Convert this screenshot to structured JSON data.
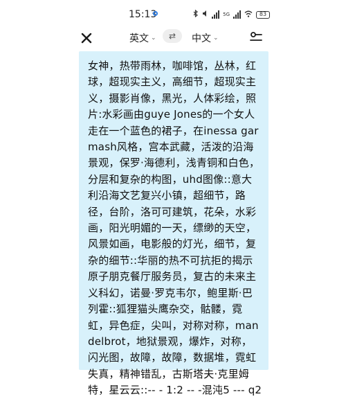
{
  "status_bar": {
    "time": "15:13",
    "network_label": "5G",
    "battery": "83"
  },
  "toolbar": {
    "source_language": "英文",
    "target_language": "中文",
    "swap_icon": "⇄"
  },
  "content": {
    "text": "女神，热带雨林，咖啡馆，丛林，红球，超现实主义，高细节，超现实主义，摄影肖像，黑光，人体彩绘，照片:水彩画由guye Jones的一个女人走在一个蓝色的裙子，在inessa garmash风格，宫本武藏，活泼的沿海景观，保罗·海德利，浅青铜和白色，分层和复杂的构图，uhd图像::意大利沿海文艺复兴小镇，超细节，路径，台阶，洛可可建筑，花朵，水彩画，阳光明媚的一天，缥缈的天空，风景如画，电影般的灯光，细节，复杂的细节::华丽的热不可抗拒的揭示原子朋克餐厅服务员，复古的未来主义科幻，诺曼·罗克韦尔，鲍里斯·巴列霍::狐狸猫头鹰杂交，骷髅，霓虹，异色症，尖叫，对称对称，mandelbrot，地狱景观，爆炸，对称，闪光图，故障，故障，数据堆，霓虹失真，精神错乱，古斯塔夫·克里姆特，星云云::-- - 1:2 -- -混沌5 --- q2"
  },
  "colors": {
    "card_background": "#d8f1fb",
    "accent_blue": "#2f7de1"
  }
}
